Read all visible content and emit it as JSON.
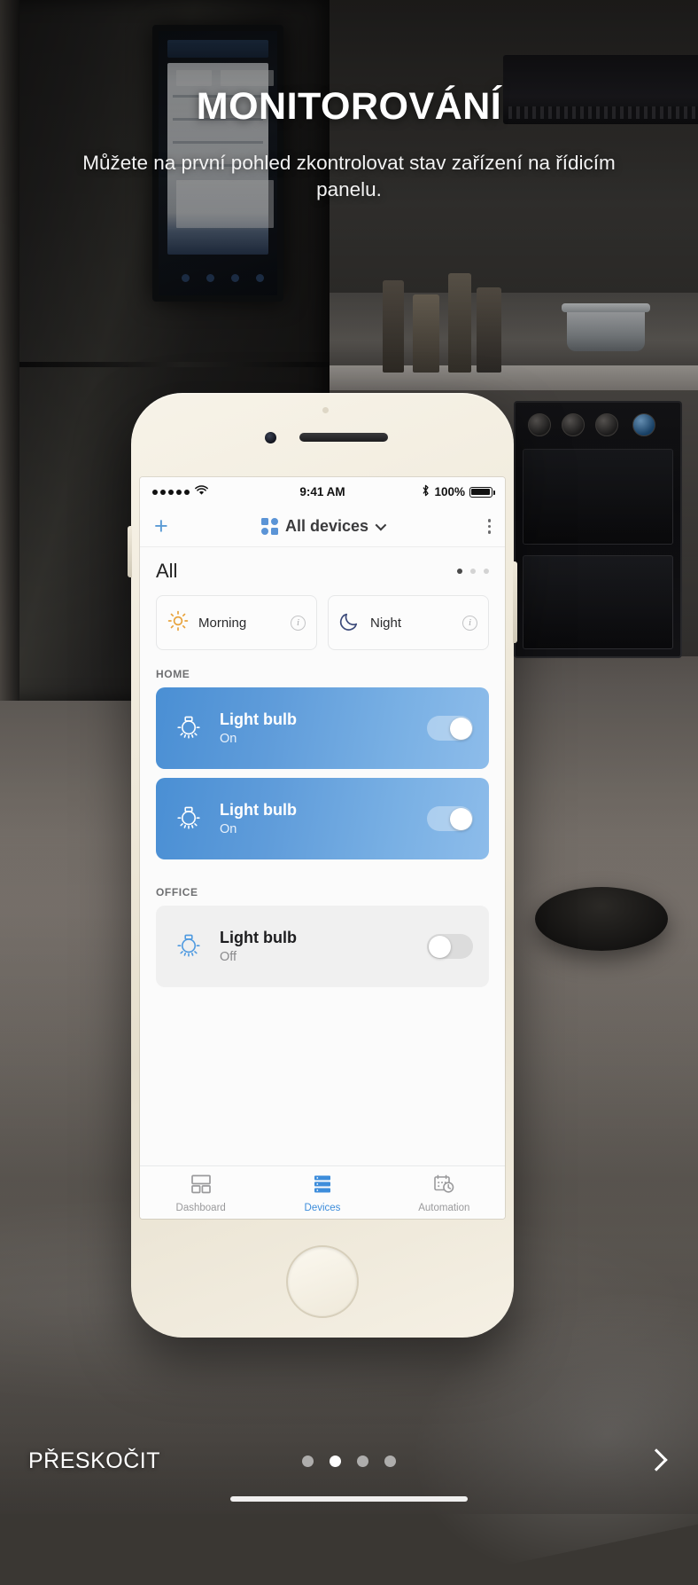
{
  "onboarding": {
    "title": "MONITOROVÁNÍ",
    "subtitle": "Můžete na první pohled zkontrolovat stav zařízení na řídicím panelu.",
    "skip_label": "PŘESKOČIT",
    "next_icon": "chevron-right-icon",
    "page_dots": {
      "count": 4,
      "active_index": 1
    }
  },
  "phone": {
    "status_bar": {
      "signal": "•••••",
      "wifi_icon": "wifi-icon",
      "time": "9:41 AM",
      "bluetooth_icon": "bluetooth-icon",
      "battery_percent": "100%"
    },
    "nav": {
      "add_label": "+",
      "grid_icon": "devices-grid-icon",
      "title": "All devices",
      "chevron_icon": "chevron-down-icon",
      "more_icon": "more-vertical-icon"
    },
    "all_row": {
      "label": "All",
      "dots": {
        "count": 3,
        "active_index": 0
      }
    },
    "scenes": [
      {
        "name": "Morning",
        "icon": "sun-icon",
        "info_icon": "info-icon",
        "accent": "#e8a33d"
      },
      {
        "name": "Night",
        "icon": "moon-icon",
        "info_icon": "info-icon",
        "accent": "#3c4a7a"
      }
    ],
    "groups": [
      {
        "label": "HOME",
        "devices": [
          {
            "name": "Light bulb",
            "state": "On",
            "icon": "light-bulb-icon",
            "toggle": "on"
          },
          {
            "name": "Light bulb",
            "state": "On",
            "icon": "light-bulb-icon",
            "toggle": "on"
          }
        ]
      },
      {
        "label": "OFFICE",
        "devices": [
          {
            "name": "Light bulb",
            "state": "Off",
            "icon": "light-bulb-icon",
            "toggle": "off"
          }
        ]
      }
    ],
    "tabs": [
      {
        "label": "Dashboard",
        "icon": "dashboard-icon",
        "active": false
      },
      {
        "label": "Devices",
        "icon": "devices-list-icon",
        "active": true
      },
      {
        "label": "Automation",
        "icon": "automation-calendar-clock-icon",
        "active": false
      }
    ]
  },
  "colors": {
    "accent_blue": "#3d8ddb",
    "card_on_from": "#4a8fd4",
    "card_on_to": "#8dbcea",
    "card_off": "#f0f0f0",
    "sun_orange": "#e8a33d",
    "moon_navy": "#3c4a7a"
  }
}
